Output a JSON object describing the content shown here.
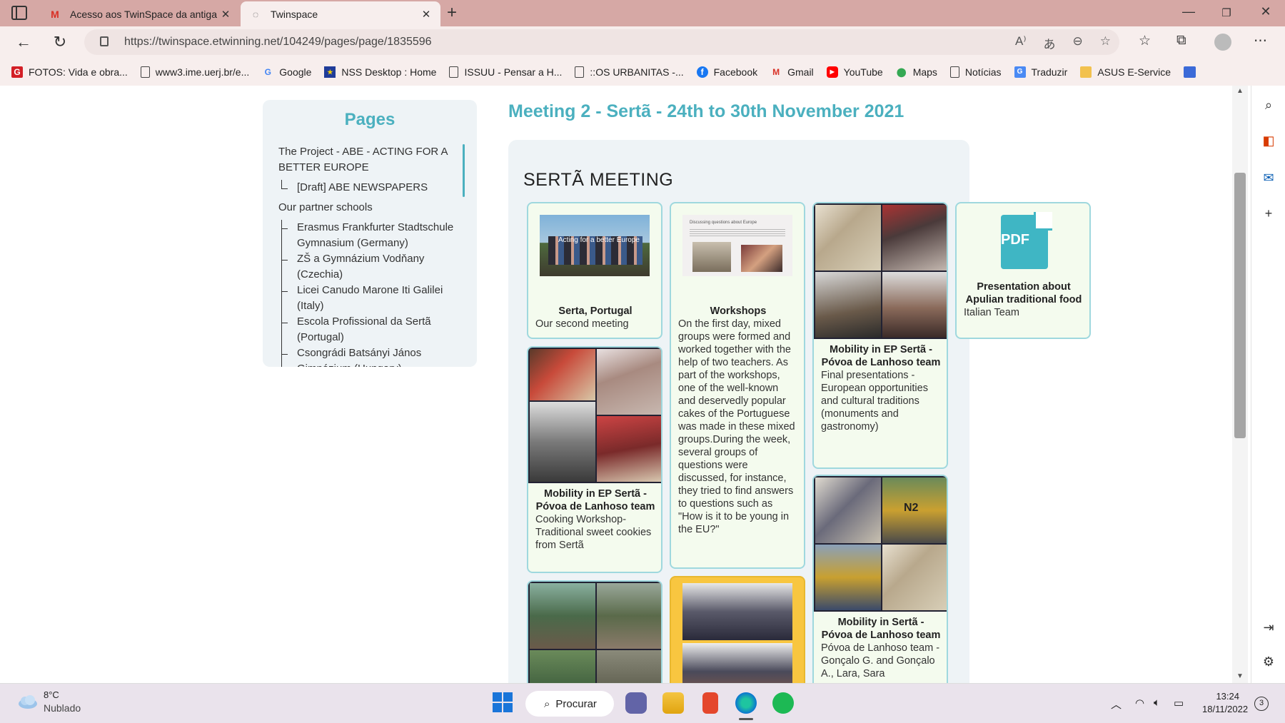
{
  "browser": {
    "tabs": [
      {
        "label": "Acesso aos TwinSpace da antiga",
        "favicon": "gmail-icon"
      },
      {
        "label": "Twinspace",
        "favicon": "twinspace-icon"
      }
    ],
    "url": "https://twinspace.etwinning.net/104249/pages/page/1835596"
  },
  "bookmarks": [
    {
      "label": "FOTOS: Vida e obra...",
      "icon": "generic-red-icon"
    },
    {
      "label": "www3.ime.uerj.br/e...",
      "icon": "file-icon"
    },
    {
      "label": "Google",
      "icon": "google-icon"
    },
    {
      "label": "NSS Desktop : Home",
      "icon": "eu-flag-icon"
    },
    {
      "label": "ISSUU - Pensar a H...",
      "icon": "file-icon"
    },
    {
      "label": "::OS URBANITAS -...",
      "icon": "file-icon"
    },
    {
      "label": "Facebook",
      "icon": "facebook-icon"
    },
    {
      "label": "Gmail",
      "icon": "gmail-icon"
    },
    {
      "label": "YouTube",
      "icon": "youtube-icon"
    },
    {
      "label": "Maps",
      "icon": "maps-icon"
    },
    {
      "label": "Notícias",
      "icon": "file-icon"
    },
    {
      "label": "Traduzir",
      "icon": "translate-icon"
    },
    {
      "label": "ASUS E-Service",
      "icon": "folder-icon"
    }
  ],
  "sidebar": {
    "title": "Pages",
    "items": [
      {
        "label": "The Project - ABE - ACTING FOR A BETTER EUROPE",
        "level": 0
      },
      {
        "label": "[Draft] ABE NEWSPAPERS",
        "level": 1
      },
      {
        "label": "Our partner schools",
        "level": 0
      },
      {
        "label": "Erasmus Frankfurter Stadtschule Gymnasium (Germany)",
        "level": 1
      },
      {
        "label": "ZŠ a Gymnázium Vodňany (Czechia)",
        "level": 1
      },
      {
        "label": "Licei Canudo Marone Iti Galilei (Italy)",
        "level": 1
      },
      {
        "label": "Escola Profissional da Sertã (Portugal)",
        "level": 1
      },
      {
        "label": "Csongrádi Batsányi János Gimnázium (Hungary)",
        "level": 1
      }
    ]
  },
  "main": {
    "heading": "Meeting 2 - Sertã - 24th to 30th November 2021",
    "section_title": "SERTÃ MEETING",
    "cards": [
      {
        "title": "Serta, Portugal",
        "desc": "Our second meeting",
        "image_caption": "Acting for a better Europe"
      },
      {
        "title": "Workshops",
        "desc": "On the first day, mixed groups were formed and worked together with the help of two teachers. As part of the workshops, one of the well-known and deservedly popular cakes of the Portuguese was made in these mixed groups.During the week, several groups of questions were discussed, for instance, they tried to find answers to questions such as \"How is it to be young in the EU?\"",
        "image_caption": "Discussing questions about Europe"
      },
      {
        "title": "Mobility in EP Sertã - Póvoa de Lanhoso team",
        "desc": "Final presentations - European opportunities and cultural traditions (monuments and gastronomy)"
      },
      {
        "title": "Presentation about Apulian traditional food",
        "desc": "Italian Team",
        "badge": "PDF"
      },
      {
        "title": "Mobility in EP Sertã - Póvoa de Lanhoso team",
        "desc": "Cooking Workshop- Traditional sweet cookies from Sertã"
      },
      {
        "title": "Mobility in Sertã - Póvoa de Lanhoso team",
        "desc": "Póvoa de Lanhoso team -Gonçalo G. and Gonçalo A., Lara, Sara",
        "image_caption": "N2"
      }
    ]
  },
  "taskbar": {
    "temperature": "8°C",
    "condition": "Nublado",
    "search_label": "Procurar",
    "time": "13:24",
    "date": "18/11/2022",
    "notifications": "3"
  }
}
